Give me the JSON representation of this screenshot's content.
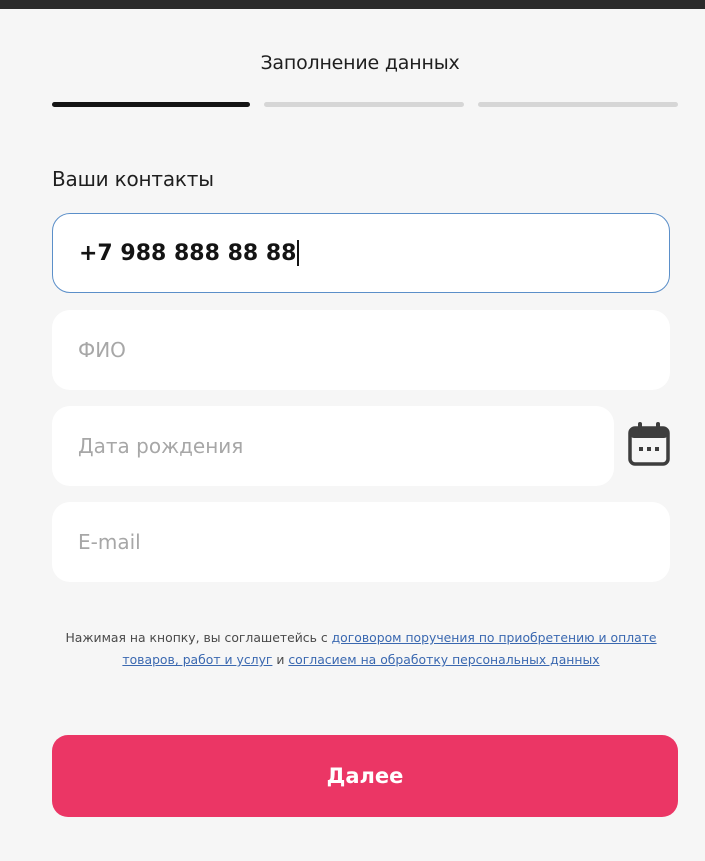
{
  "header": {
    "title": "Заполнение данных",
    "steps": [
      {
        "state": "active"
      },
      {
        "state": "inactive"
      },
      {
        "state": "inactive"
      }
    ]
  },
  "contacts": {
    "section_title": "Ваши контакты",
    "phone": {
      "value": "+7 988 888 88 88",
      "placeholder": ""
    },
    "fio": {
      "value": "",
      "placeholder": "ФИО"
    },
    "birth_date": {
      "value": "",
      "placeholder": "Дата рождения",
      "icon": "calendar-icon"
    },
    "email": {
      "value": "",
      "placeholder": "E-mail"
    }
  },
  "consent": {
    "prefix": "Нажимая на кнопку, вы соглашетейсь с ",
    "link_agreement": "договором поручения по приобретению и оплате товаров, работ и услуг",
    "middle": " и ",
    "link_personal_data": "согласием на обработку персональных данных"
  },
  "actions": {
    "next_label": "Далее"
  },
  "colors": {
    "accent": "#eb3665",
    "active_step": "#141414",
    "inactive_step": "#d6d6d6",
    "focus_border": "#5b8fc9",
    "link": "#3a68b0",
    "background": "#f6f6f6"
  }
}
